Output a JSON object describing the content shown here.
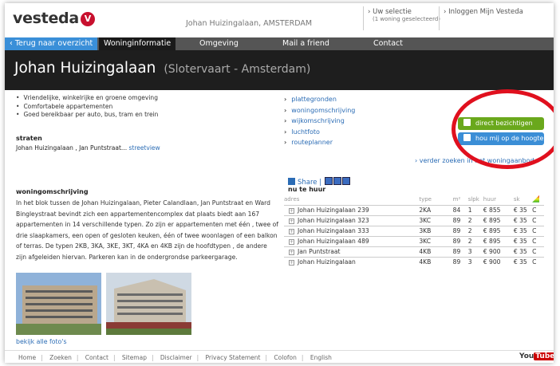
{
  "header": {
    "logo_text": "vesteda",
    "address": "Johan Huizingalaan, AMSTERDAM",
    "selection_link": "Uw selectie",
    "selection_sub": "(1 woning geselecteerd)",
    "login_link": "Inloggen Mijn Vesteda"
  },
  "nav": {
    "back": "Terug naar overzicht",
    "tabs": [
      "Woninginformatie",
      "Omgeving",
      "Mail a friend",
      "Contact"
    ]
  },
  "title": {
    "name": "Johan Huizingalaan",
    "location": "(Slotervaart - Amsterdam)"
  },
  "features": [
    "Vriendelijke, winkelrijke en groene omgeving",
    "Comfortabele appartementen",
    "Goed bereikbaar per auto, bus, tram en trein"
  ],
  "straten": {
    "heading": "straten",
    "value": "Johan Huizingalaan , Jan Puntstraat...",
    "streetview": "streetview"
  },
  "links": [
    "plattegronden",
    "woningomschrijving",
    "wijkomschrijving",
    "luchtfoto",
    "routeplanner"
  ],
  "buttons": {
    "bezichtigen": "direct bezichtigen",
    "hoogte": "hou mij op de hoogte",
    "verder": "verder zoeken in het woningaanbod"
  },
  "omschrijving": {
    "heading": "woningomschrijving",
    "text": "In het blok tussen de Johan Huizingalaan, Pieter Calandlaan, Jan Puntstraat en Ward Bingleystraat bevindt zich een appartementencomplex dat plaats biedt aan 167 appartementen in 14 verschillende typen. Zo zijn er appartementen met één , twee of drie slaapkamers, een open of gesloten keuken, één of twee woonlagen of een balkon of terras. De typen 2KB, 3KA, 3KE, 3KT, 4KA en 4KB zijn de hoofdtypen , de andere zijn afgeleiden hiervan. Parkeren kan in de ondergrondse parkeergarage."
  },
  "photos_link": "bekijk alle foto's",
  "share": {
    "label": "Share",
    "heading": "nu te huur"
  },
  "table": {
    "headers": [
      "adres",
      "type",
      "m²",
      "slpk",
      "huur",
      "sk"
    ],
    "rows": [
      [
        "Johan Huizingalaan 239",
        "2KA",
        "84",
        "1",
        "€ 855",
        "€ 35",
        "C"
      ],
      [
        "Johan Huizingalaan 323",
        "3KC",
        "89",
        "2",
        "€ 895",
        "€ 35",
        "C"
      ],
      [
        "Johan Huizingalaan 333",
        "3KB",
        "89",
        "2",
        "€ 895",
        "€ 35",
        "C"
      ],
      [
        "Johan Huizingalaan 489",
        "3KC",
        "89",
        "2",
        "€ 895",
        "€ 35",
        "C"
      ],
      [
        "Jan Puntstraat",
        "4KB",
        "89",
        "3",
        "€ 900",
        "€ 35",
        "C"
      ],
      [
        "Johan Huizingalaan",
        "4KB",
        "89",
        "3",
        "€ 900",
        "€ 35",
        "C"
      ]
    ]
  },
  "footer": {
    "items": [
      "Home",
      "Zoeken",
      "Contact",
      "Sitemap",
      "Disclaimer",
      "Privacy Statement",
      "Colofon",
      "English"
    ],
    "youtube_a": "You",
    "youtube_b": "Tube"
  },
  "colors": {
    "accent_red": "#e0101e",
    "nav_back": "#3a8fd8",
    "btn_green": "#6aa81c",
    "btn_blue": "#3b8ed6"
  }
}
